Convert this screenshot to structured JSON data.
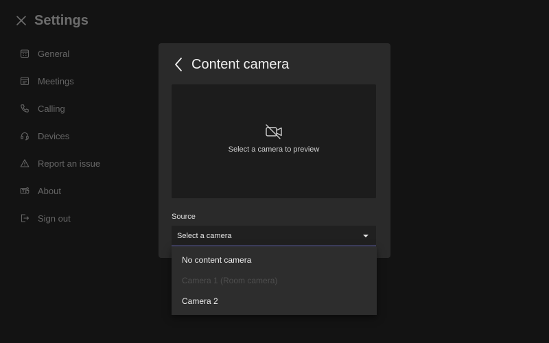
{
  "settings": {
    "title": "Settings",
    "nav": [
      {
        "label": "General",
        "icon": "calendar-grid-icon"
      },
      {
        "label": "Meetings",
        "icon": "calendar-icon"
      },
      {
        "label": "Calling",
        "icon": "phone-icon"
      },
      {
        "label": "Devices",
        "icon": "headset-icon"
      },
      {
        "label": "Report an issue",
        "icon": "warning-icon"
      },
      {
        "label": "About",
        "icon": "teams-icon"
      },
      {
        "label": "Sign out",
        "icon": "sign-out-icon"
      }
    ]
  },
  "modal": {
    "title": "Content camera",
    "preview_text": "Select a camera to preview",
    "source_label": "Source",
    "dropdown_value": "Select a camera",
    "options": [
      {
        "label": "No content camera",
        "enabled": true
      },
      {
        "label": "Camera 1 (Room camera)",
        "enabled": false
      },
      {
        "label": "Camera 2",
        "enabled": true
      }
    ]
  },
  "colors": {
    "background": "#0f0f0f",
    "modal": "#2a2a2a",
    "accent_underline": "#7a7bd6",
    "disabled_text": "#4f4f4f"
  }
}
